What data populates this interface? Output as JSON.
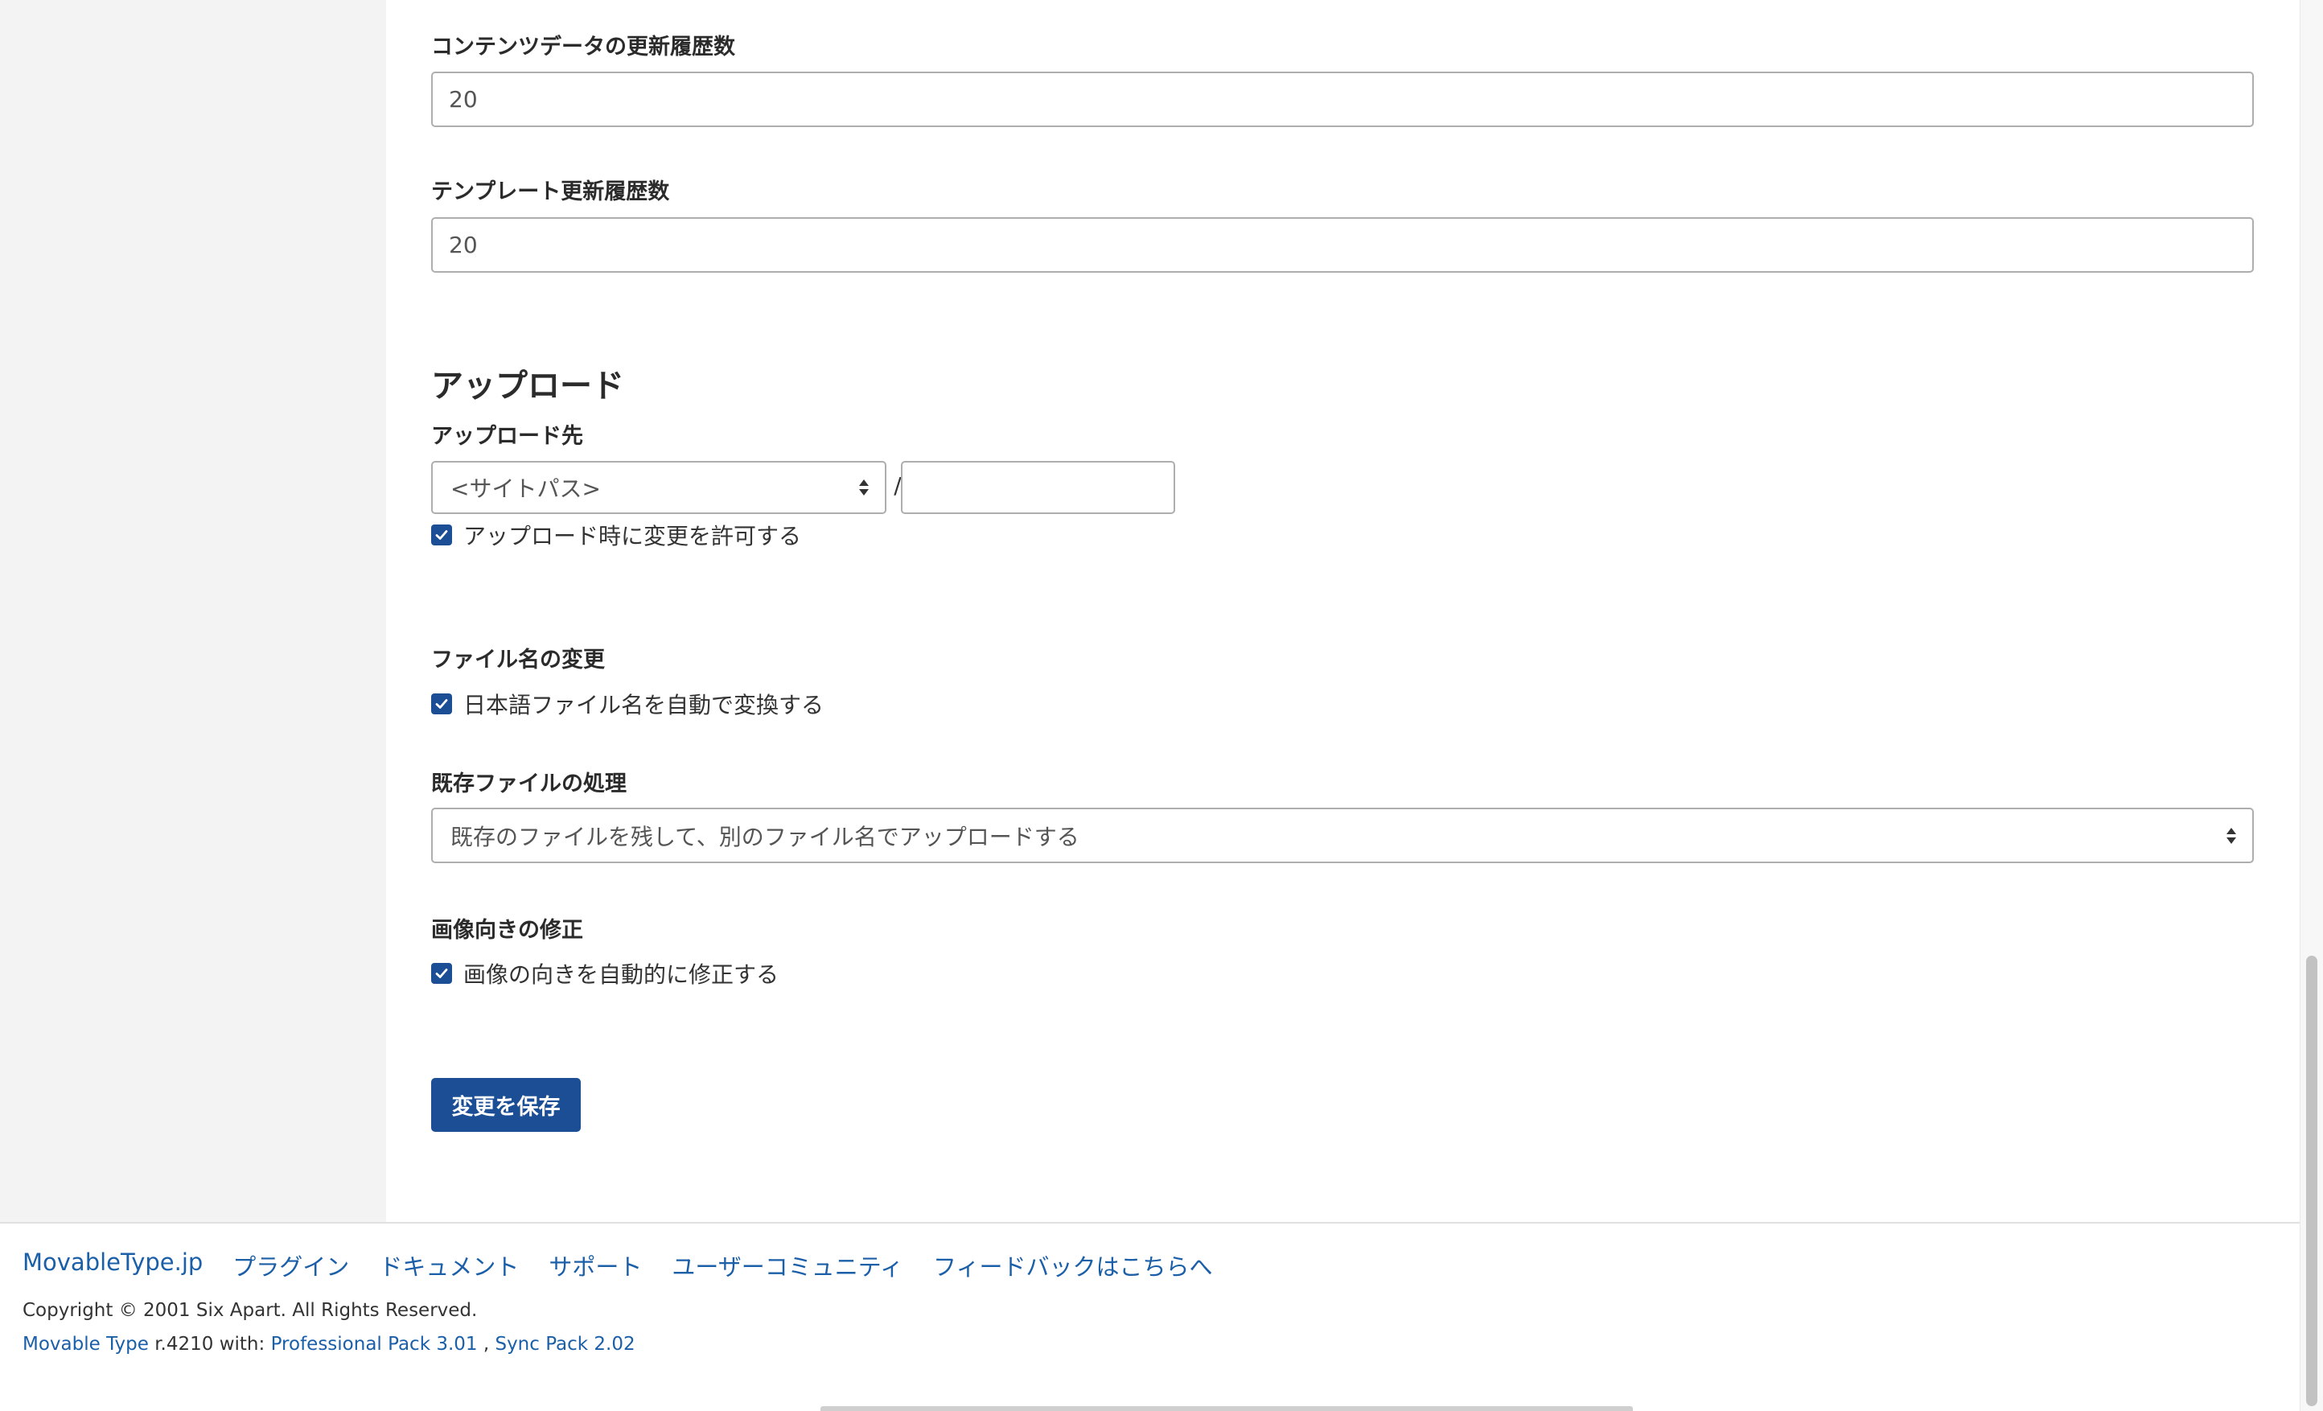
{
  "settings": {
    "content_revisions_label": "コンテンツデータの更新履歴数",
    "content_revisions_value": "20",
    "template_revisions_label": "テンプレート更新履歴数",
    "template_revisions_value": "20"
  },
  "upload": {
    "section_title": "アップロード",
    "destination_label": "アップロード先",
    "destination_select": "<サイトパス>",
    "path_separator": "/",
    "subpath_value": "",
    "allow_change_label": "アップロード時に変更を許可する",
    "allow_change_checked": true,
    "rename_label": "ファイル名の変更",
    "auto_rename_japanese_label": "日本語ファイル名を自動で変換する",
    "auto_rename_checked": true,
    "existing_file_label": "既存ファイルの処理",
    "existing_file_select": "既存のファイルを残して、別のファイル名でアップロードする",
    "orientation_label": "画像向きの修正",
    "auto_orientation_label": "画像の向きを自動的に修正する",
    "auto_orientation_checked": true,
    "save_button": "変更を保存"
  },
  "footer": {
    "links": [
      "MovableType.jp",
      "プラグイン",
      "ドキュメント",
      "サポート",
      "ユーザーコミュニティ",
      "フィードバックはこちらへ"
    ],
    "copyright": "Copyright © 2001 Six Apart. All Rights Reserved.",
    "product_link": "Movable Type",
    "version_text": " r.4210 with: ",
    "pack1_link": "Professional Pack 3.01",
    "pack_separator": " , ",
    "pack2_link": "Sync Pack 2.02"
  },
  "colors": {
    "accent": "#1b4e94",
    "link": "#1b5fa8",
    "sidebar_bg": "#f3f3f3"
  },
  "icons": {
    "checkbox": "check-icon",
    "select_arrows": "updown-chevron-icon"
  }
}
